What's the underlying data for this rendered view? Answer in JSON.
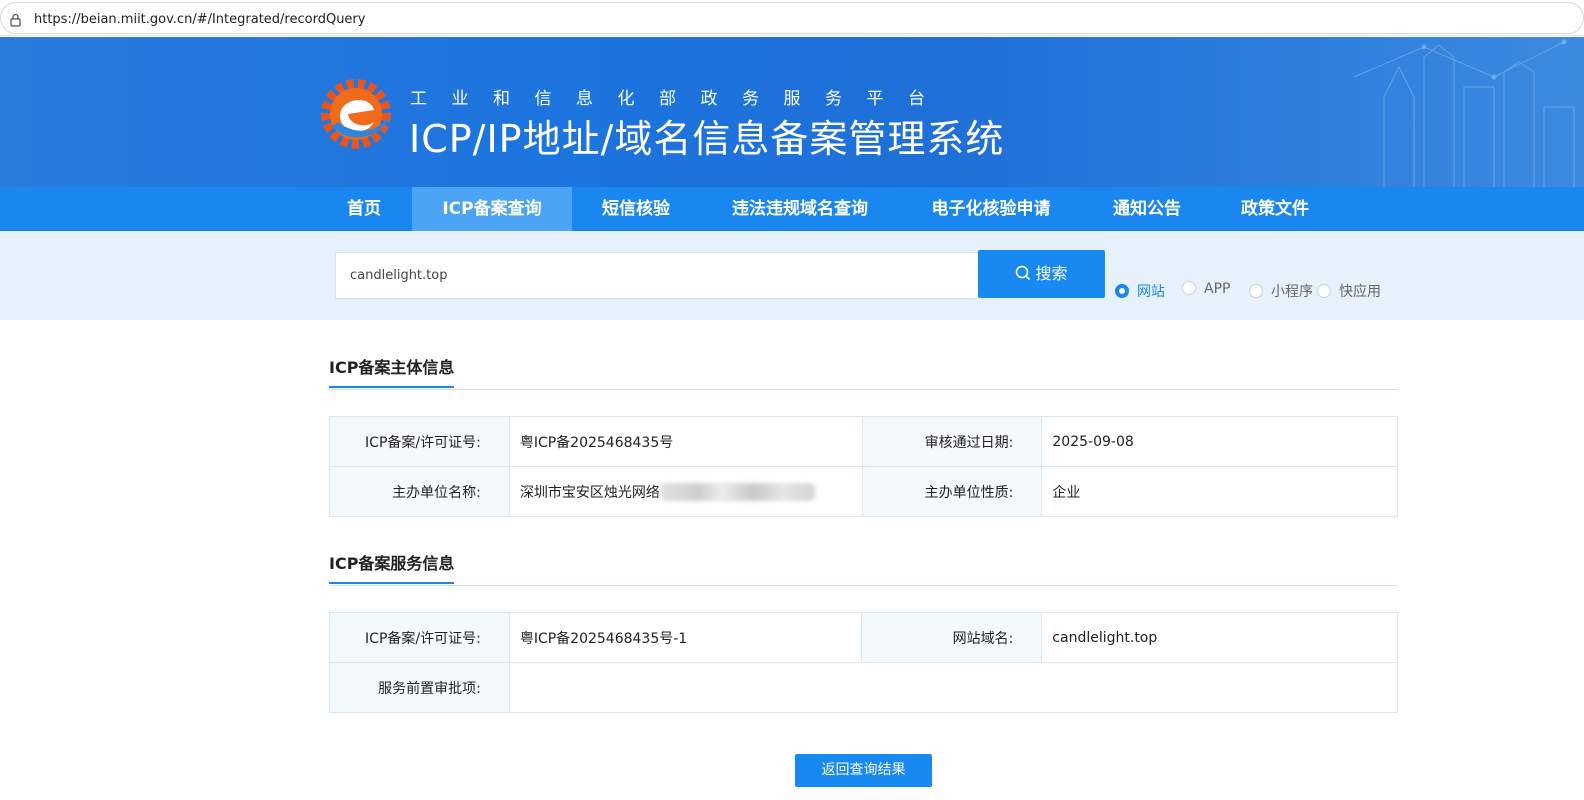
{
  "browser": {
    "url": "https://beian.miit.gov.cn/#/Integrated/recordQuery"
  },
  "header": {
    "subtitle": "工业和信息化部政务服务平台",
    "title": "ICP/IP地址/域名信息备案管理系统"
  },
  "nav": {
    "items": [
      {
        "label": "首页"
      },
      {
        "label": "ICP备案查询"
      },
      {
        "label": "短信核验"
      },
      {
        "label": "违法违规域名查询"
      },
      {
        "label": "电子化核验申请"
      },
      {
        "label": "通知公告"
      },
      {
        "label": "政策文件"
      }
    ],
    "active": "ICP备案查询"
  },
  "search": {
    "value": "candlelight.top",
    "button_label": "搜索",
    "types": [
      {
        "label": "网站",
        "checked": true
      },
      {
        "label": "APP",
        "checked": false
      },
      {
        "label": "小程序",
        "checked": false
      },
      {
        "label": "快应用",
        "checked": false
      }
    ]
  },
  "subject": {
    "title": "ICP备案主体信息",
    "license_label": "ICP备案/许可证号:",
    "license_value": "粤ICP备2025468435号",
    "approve_date_label": "审核通过日期:",
    "approve_date_value": "2025-09-08",
    "org_name_label": "主办单位名称:",
    "org_name_value": "深圳市宝安区烛光网络",
    "org_type_label": "主办单位性质:",
    "org_type_value": "企业"
  },
  "service": {
    "title": "ICP备案服务信息",
    "license_label": "ICP备案/许可证号:",
    "license_value": "粤ICP备2025468435号-1",
    "domain_label": "网站域名:",
    "domain_value": "candlelight.top",
    "preapproval_label": "服务前置审批项:",
    "preapproval_value": ""
  },
  "back_button_label": "返回查询结果",
  "colors": {
    "primary": "#1789f0",
    "nav_bg": "#1a86f0",
    "nav_active": "#4aa3f4",
    "search_bg": "#e6f1fc",
    "logo_orange": "#e8551f"
  }
}
